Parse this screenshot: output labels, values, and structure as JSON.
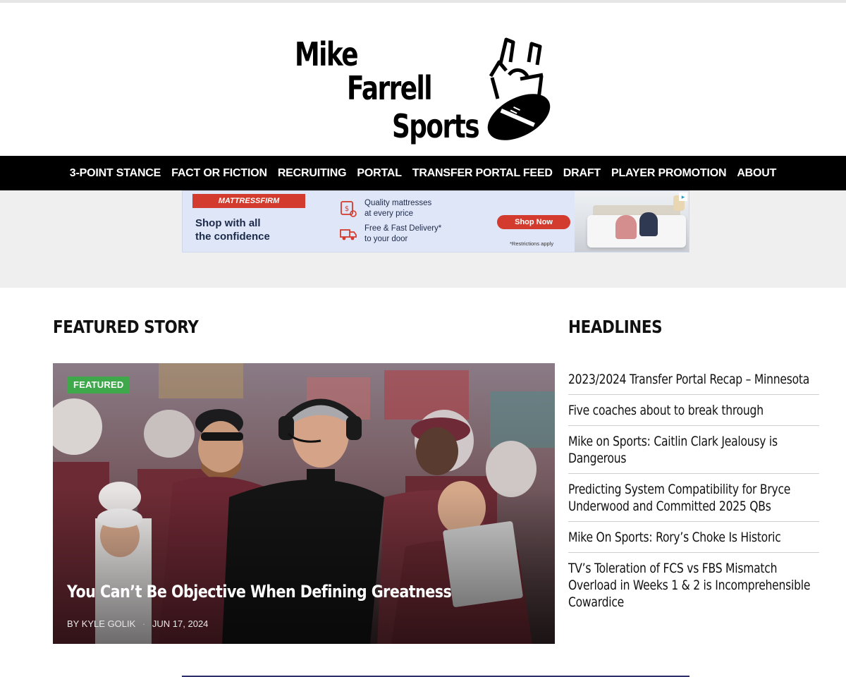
{
  "logo": {
    "line1": "Mike",
    "line2": "Farrell",
    "line3": "Sports",
    "mark_icon": "football-uprights-icon"
  },
  "nav": {
    "items": [
      {
        "label": "3-POINT STANCE"
      },
      {
        "label": "FACT OR FICTION"
      },
      {
        "label": "RECRUITING"
      },
      {
        "label": "PORTAL"
      },
      {
        "label": "TRANSFER PORTAL FEED"
      },
      {
        "label": "DRAFT"
      },
      {
        "label": "PLAYER PROMOTION"
      },
      {
        "label": "ABOUT"
      }
    ]
  },
  "ad": {
    "brand": "MATTRESSFIRM",
    "tagline_line1": "Shop with all",
    "tagline_line2": "the confidence",
    "feature1_line1": "Quality mattresses",
    "feature1_line2": "at every price",
    "feature2_line1": "Free & Fast Delivery*",
    "feature2_line2": "to your door",
    "cta": "Shop Now",
    "restrictions": "*Restrictions apply",
    "brand_color": "#d23b2d"
  },
  "featured": {
    "heading": "FEATURED STORY",
    "badge": "FEATURED",
    "badge_color": "#3ea84a",
    "title": "You Can’t Be Objective When Defining Greatness",
    "author": "BY KYLE GOLIK",
    "separator": "·",
    "date": "JUN 17, 2024"
  },
  "headlines": {
    "heading": "HEADLINES",
    "items": [
      {
        "title": "2023/2024 Transfer Portal Recap – Minnesota"
      },
      {
        "title": "Five coaches about to break through"
      },
      {
        "title": "Mike on Sports: Caitlin Clark Jealousy is Dangerous"
      },
      {
        "title": "Predicting System Compatibility for Bryce Underwood and Committed 2025 QBs"
      },
      {
        "title": "Mike On Sports: Rory’s Choke Is Historic"
      },
      {
        "title": "TV’s Toleration of FCS vs FBS Mismatch Overload in Weeks 1 & 2 is Incomprehensible Cowardice"
      }
    ]
  }
}
